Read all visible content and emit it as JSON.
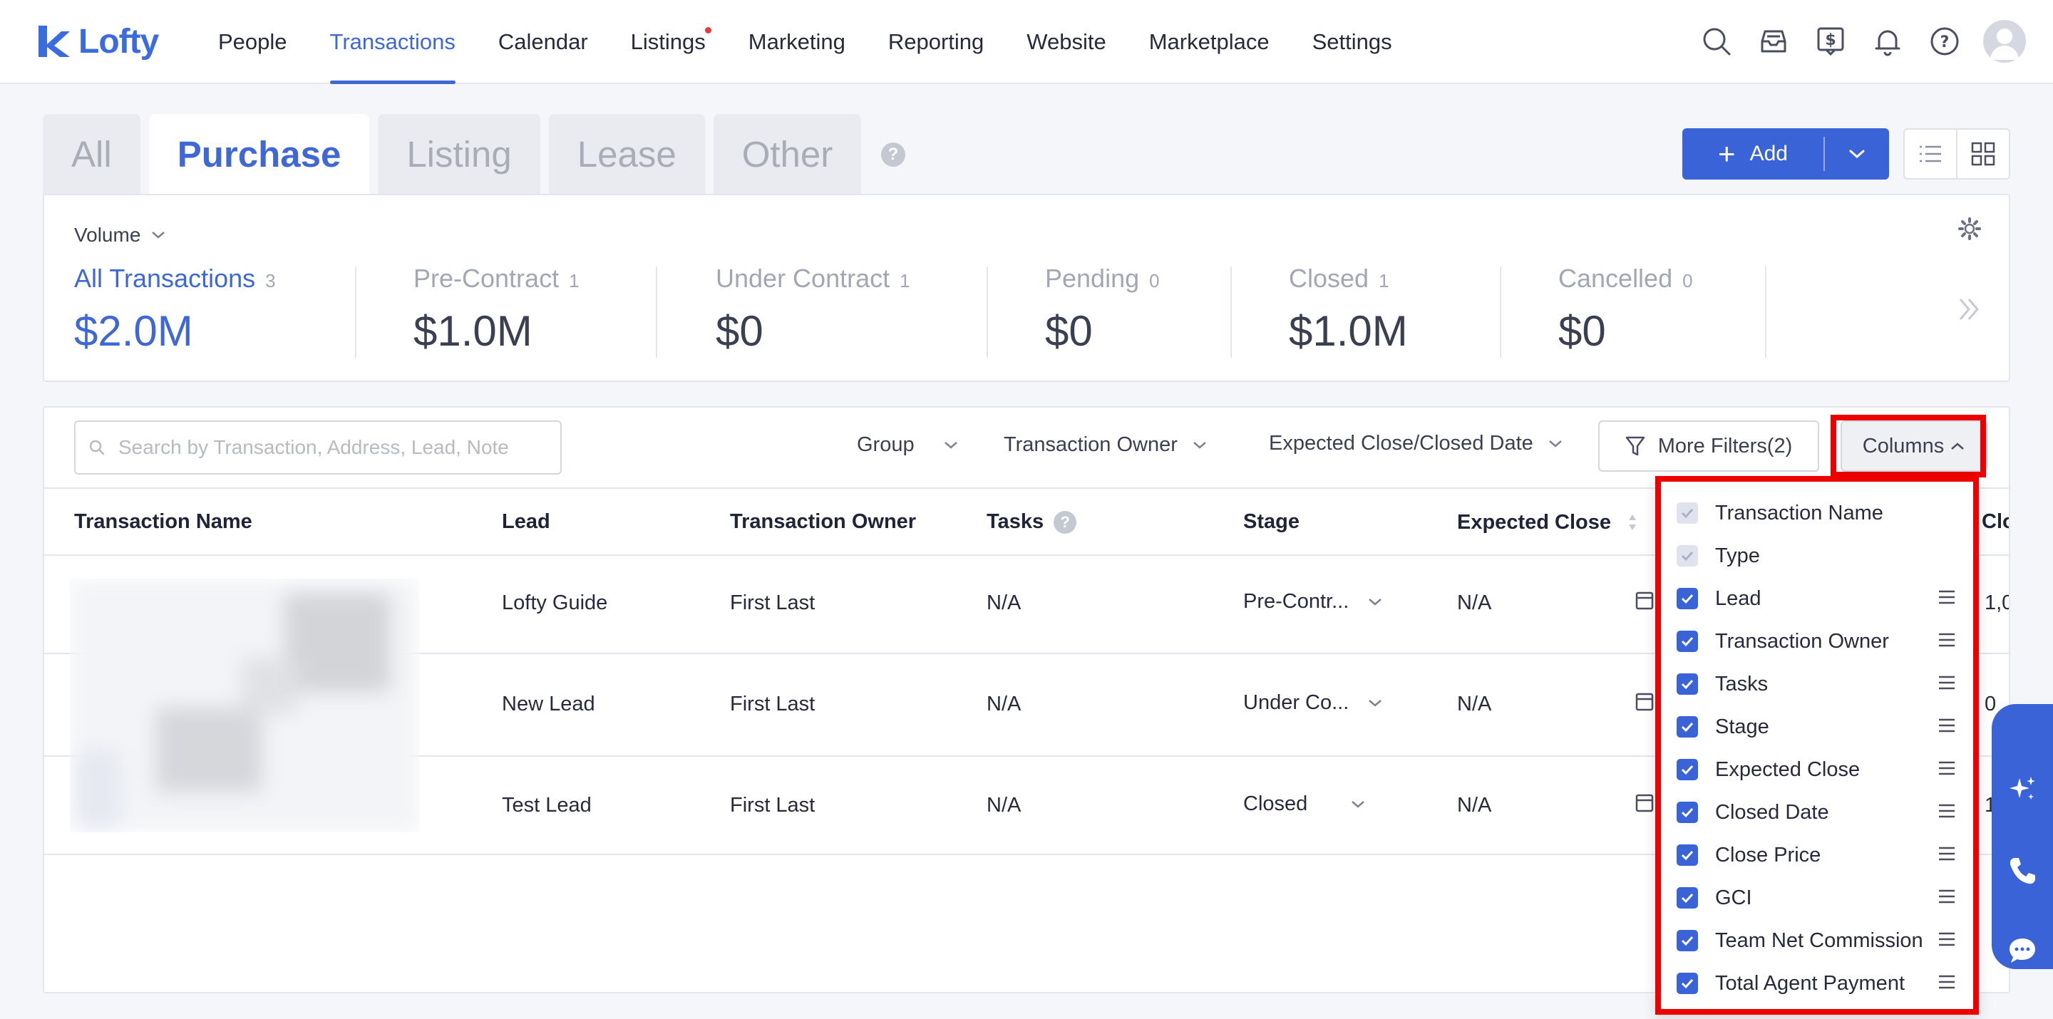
{
  "app": {
    "brand": "Lofty",
    "brand_color": "#3f68d6"
  },
  "nav": {
    "items": [
      {
        "label": "People",
        "active": false
      },
      {
        "label": "Transactions",
        "active": true
      },
      {
        "label": "Calendar",
        "active": false
      },
      {
        "label": "Listings",
        "active": false,
        "dot": true
      },
      {
        "label": "Marketing",
        "active": false
      },
      {
        "label": "Reporting",
        "active": false
      },
      {
        "label": "Website",
        "active": false
      },
      {
        "label": "Marketplace",
        "active": false
      },
      {
        "label": "Settings",
        "active": false
      }
    ],
    "icons": [
      "search-icon",
      "inbox-icon",
      "dollar-icon",
      "bell-icon",
      "help-icon",
      "avatar"
    ]
  },
  "tabs": [
    {
      "label": "All",
      "active": false
    },
    {
      "label": "Purchase",
      "active": true
    },
    {
      "label": "Listing",
      "active": false
    },
    {
      "label": "Lease",
      "active": false
    },
    {
      "label": "Other",
      "active": false
    }
  ],
  "tab_help": "?",
  "toolbar": {
    "add_label": "Add"
  },
  "stats": {
    "volume_label": "Volume",
    "items": [
      {
        "label": "All Transactions",
        "count": "3",
        "value": "$2.0M",
        "active": true
      },
      {
        "label": "Pre-Contract",
        "count": "1",
        "value": "$1.0M",
        "active": false
      },
      {
        "label": "Under Contract",
        "count": "1",
        "value": "$0",
        "active": false
      },
      {
        "label": "Pending",
        "count": "0",
        "value": "$0",
        "active": false
      },
      {
        "label": "Closed",
        "count": "1",
        "value": "$1.0M",
        "active": false
      },
      {
        "label": "Cancelled",
        "count": "0",
        "value": "$0",
        "active": false
      }
    ]
  },
  "table": {
    "search_placeholder": "Search by Transaction, Address, Lead, Note",
    "filters": {
      "group": "Group",
      "owner": "Transaction Owner",
      "date": "Expected Close/Closed Date",
      "more": "More Filters(2)",
      "columns": "Columns"
    },
    "headers": {
      "name": "Transaction Name",
      "lead": "Lead",
      "owner": "Transaction Owner",
      "tasks": "Tasks",
      "stage": "Stage",
      "expected_close": "Expected Close",
      "closed_partial": "Clos"
    },
    "rows": [
      {
        "lead": "Lofty Guide",
        "owner": "First Last",
        "tasks": "N/A",
        "stage": "Pre-Contr...",
        "expected_close": "N/A",
        "trailing": "1,0"
      },
      {
        "lead": "New Lead",
        "owner": "First Last",
        "tasks": "N/A",
        "stage": "Under Co...",
        "expected_close": "N/A",
        "trailing": "0"
      },
      {
        "lead": "Test Lead",
        "owner": "First Last",
        "tasks": "N/A",
        "stage": "Closed",
        "expected_close": "N/A",
        "trailing": "1"
      }
    ]
  },
  "columns_menu": {
    "items": [
      {
        "label": "Transaction Name",
        "checked": true,
        "disabled": true,
        "draggable": false
      },
      {
        "label": "Type",
        "checked": true,
        "disabled": true,
        "draggable": false
      },
      {
        "label": "Lead",
        "checked": true,
        "disabled": false,
        "draggable": true
      },
      {
        "label": "Transaction Owner",
        "checked": true,
        "disabled": false,
        "draggable": true
      },
      {
        "label": "Tasks",
        "checked": true,
        "disabled": false,
        "draggable": true
      },
      {
        "label": "Stage",
        "checked": true,
        "disabled": false,
        "draggable": true
      },
      {
        "label": "Expected Close",
        "checked": true,
        "disabled": false,
        "draggable": true
      },
      {
        "label": "Closed Date",
        "checked": true,
        "disabled": false,
        "draggable": true
      },
      {
        "label": "Close Price",
        "checked": true,
        "disabled": false,
        "draggable": true
      },
      {
        "label": "GCI",
        "checked": true,
        "disabled": false,
        "draggable": true
      },
      {
        "label": "Team Net Commission",
        "checked": true,
        "disabled": false,
        "draggable": true
      },
      {
        "label": "Total Agent Payment",
        "checked": true,
        "disabled": false,
        "draggable": true
      }
    ],
    "highlight_color": "#ee0000"
  },
  "side_float": [
    "sparkle-icon",
    "phone-icon",
    "chat-icon"
  ]
}
